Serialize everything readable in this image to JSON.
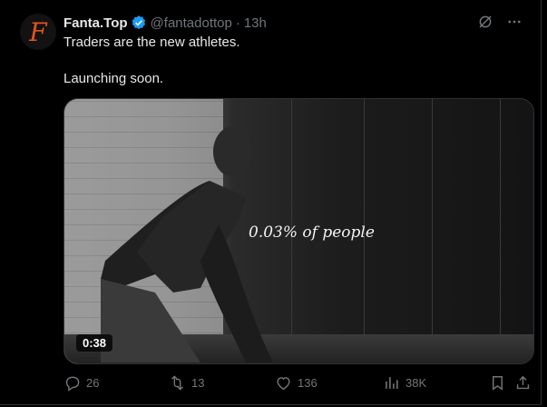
{
  "tweet": {
    "avatar_letter": "F",
    "display_name": "Fanta.Top",
    "handle": "@fantadottop",
    "separator": "·",
    "time": "13h",
    "text_line1": "Traders are the new athletes.",
    "text_line2": "Launching soon."
  },
  "media": {
    "overlay_text": "0.03% of people",
    "duration": "0:38"
  },
  "actions": {
    "replies": "26",
    "reposts": "13",
    "likes": "136",
    "views": "38K"
  },
  "colors": {
    "background": "#000000",
    "text": "#e7e9ea",
    "muted": "#71767b",
    "verified": "#1d9bf0",
    "brand": "#e0541e"
  },
  "icons": [
    "grok-icon",
    "more-icon",
    "verified-icon",
    "reply-icon",
    "repost-icon",
    "like-icon",
    "views-icon",
    "bookmark-icon",
    "share-icon"
  ]
}
